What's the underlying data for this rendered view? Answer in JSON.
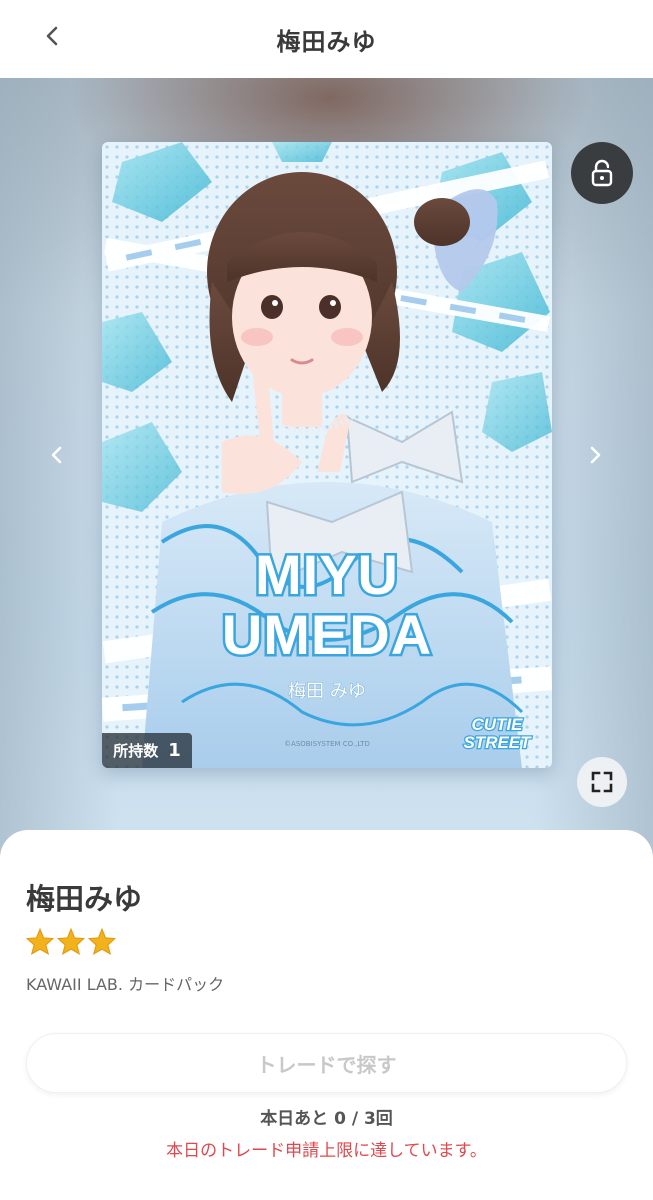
{
  "header": {
    "title": "梅田みゆ",
    "back_icon": "chevron-left-icon"
  },
  "card": {
    "art_title_line1": "MIYU",
    "art_title_line2": "UMEDA",
    "art_subtitle": "梅田 みゆ",
    "art_brand_line1": "CUTIE",
    "art_brand_line2": "STREET",
    "art_copyright": "©ASOBISYSTEM CO.,LTD",
    "owned_label": "所持数",
    "owned_count": "1"
  },
  "controls": {
    "lock_icon": "unlock-icon",
    "prev_icon": "chevron-left-icon",
    "next_icon": "chevron-right-icon",
    "expand_icon": "fullscreen-icon"
  },
  "detail": {
    "name": "梅田みゆ",
    "rarity_stars": 3,
    "pack_name": "KAWAII LAB. カードパック",
    "trade_button_label": "トレードで探す",
    "remaining_text": "本日あと 0 / 3回",
    "limit_message": "本日のトレード申請上限に達しています。"
  },
  "colors": {
    "star": "#f2b21b",
    "error_text": "#e0484e",
    "disabled_button_text": "#c8c8c8",
    "card_accent": "#3aa6e0"
  }
}
